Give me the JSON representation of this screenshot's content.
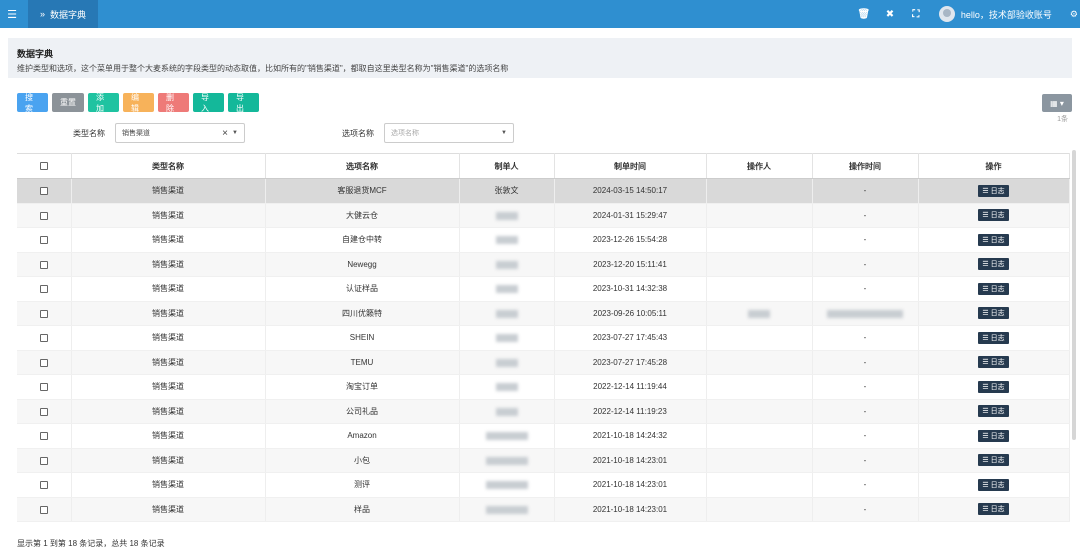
{
  "topbar": {
    "menu_icon": "☰",
    "tab_chevron": "»",
    "tab_label": "数据字典",
    "icons": [
      "trash-icon",
      "close-icon",
      "fullscreen-icon"
    ],
    "icon_glyphs": {
      "trash": "🗑",
      "close": "✖",
      "fullscreen": "⛶"
    },
    "user_greeting": "hello，技术部验收账号",
    "gear_glyph": "⚙"
  },
  "header": {
    "title": "数据字典",
    "description": "维护类型和选项，这个菜单用于整个大麦系统的字段类型的动态取值，比如所有的\"销售渠道\"，都取自这里类型名称为\"销售渠道\"的选项名称"
  },
  "toolbar": {
    "search": "搜索",
    "reset": "重置",
    "add": "添加",
    "edit": "编辑",
    "delete": "删除",
    "import": "导入",
    "export": "导出",
    "columns_glyph": "▦ ▾",
    "count_label": "1条"
  },
  "filters": {
    "type_label": "类型名称",
    "type_value": "销售渠道",
    "option_label": "选项名称",
    "option_placeholder": "选项名称"
  },
  "table": {
    "headers": [
      "类型名称",
      "选项名称",
      "制单人",
      "制单时间",
      "操作人",
      "操作时间",
      "操作"
    ],
    "log_label": "日志",
    "rows": [
      {
        "type": "销售渠道",
        "option": "客服退货MCF",
        "creator": "张敦文",
        "time": "2024-03-15 14:50:17",
        "op_time": "-",
        "selected": true
      },
      {
        "type": "销售渠道",
        "option": "大健云仓",
        "creator": "",
        "time": "2024-01-31 15:29:47",
        "op_time": "-"
      },
      {
        "type": "销售渠道",
        "option": "自建仓中转",
        "creator": "",
        "time": "2023-12-26 15:54:28",
        "op_time": "-"
      },
      {
        "type": "销售渠道",
        "option": "Newegg",
        "creator": "",
        "time": "2023-12-20 15:11:41",
        "op_time": "-"
      },
      {
        "type": "销售渠道",
        "option": "认证样品",
        "creator": "",
        "time": "2023-10-31 14:32:38",
        "op_time": "-"
      },
      {
        "type": "销售渠道",
        "option": "四川优籁特",
        "creator": "",
        "time": "2023-09-26 10:05:11",
        "op_time": "",
        "blur_ops": true
      },
      {
        "type": "销售渠道",
        "option": "SHEIN",
        "creator": "",
        "time": "2023-07-27 17:45:43",
        "op_time": "-"
      },
      {
        "type": "销售渠道",
        "option": "TEMU",
        "creator": "",
        "time": "2023-07-27 17:45:28",
        "op_time": "-"
      },
      {
        "type": "销售渠道",
        "option": "淘宝订单",
        "creator": "",
        "time": "2022-12-14 11:19:44",
        "op_time": "-"
      },
      {
        "type": "销售渠道",
        "option": "公司礼品",
        "creator": "",
        "time": "2022-12-14 11:19:23",
        "op_time": "-"
      },
      {
        "type": "销售渠道",
        "option": "Amazon",
        "creator": "",
        "time": "2021-10-18 14:24:32",
        "op_time": "-"
      },
      {
        "type": "销售渠道",
        "option": "小包",
        "creator": "",
        "time": "2021-10-18 14:23:01",
        "op_time": "-"
      },
      {
        "type": "销售渠道",
        "option": "测评",
        "creator": "",
        "time": "2021-10-18 14:23:01",
        "op_time": "-"
      },
      {
        "type": "销售渠道",
        "option": "样品",
        "creator": "",
        "time": "2021-10-18 14:23:01",
        "op_time": "-"
      }
    ]
  },
  "footer": {
    "summary": "显示第 1 到第 18 条记录，总共 18 条记录"
  }
}
